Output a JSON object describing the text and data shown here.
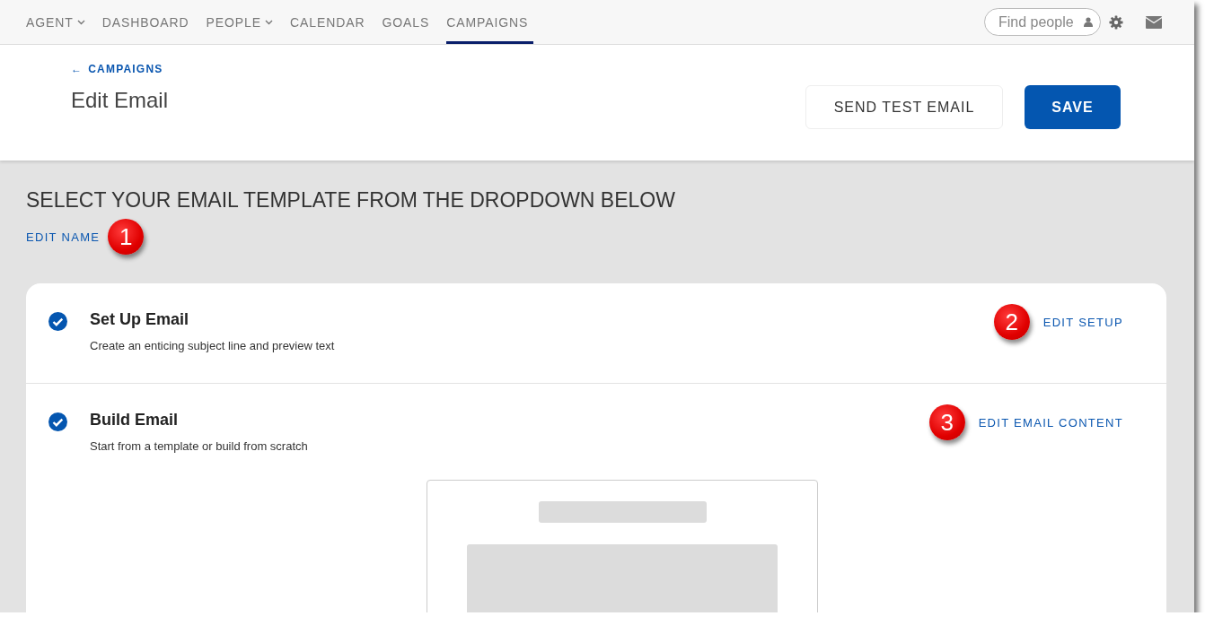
{
  "nav": {
    "items": [
      {
        "label": "AGENT",
        "dropdown": true,
        "selected": false
      },
      {
        "label": "DASHBOARD",
        "dropdown": false,
        "selected": false
      },
      {
        "label": "PEOPLE",
        "dropdown": true,
        "selected": false
      },
      {
        "label": "CALENDAR",
        "dropdown": false,
        "selected": false
      },
      {
        "label": "GOALS",
        "dropdown": false,
        "selected": false
      },
      {
        "label": "CAMPAIGNS",
        "dropdown": false,
        "selected": true
      }
    ],
    "search": {
      "placeholder": "Find people"
    }
  },
  "header": {
    "back_link": {
      "arrow": "←",
      "label": "CAMPAIGNS"
    },
    "title": "Edit Email",
    "buttons": [
      {
        "label": "SEND TEST EMAIL",
        "kind": "secondary"
      },
      {
        "label": "SAVE",
        "kind": "primary"
      }
    ]
  },
  "content": {
    "heading": "SELECT YOUR EMAIL TEMPLATE FROM THE DROPDOWN BELOW",
    "edit_link": "EDIT NAME",
    "edit_callout": "1",
    "steps": [
      {
        "title": "Set Up Email",
        "description": "Create an enticing subject line and preview text",
        "checked": true,
        "action": "EDIT SETUP",
        "callout": "2",
        "kind": "plain"
      },
      {
        "title": "Build Email",
        "description": "Start from a template or build from scratch",
        "checked": true,
        "action": "EDIT EMAIL CONTENT",
        "callout": "3",
        "kind": "preview"
      }
    ]
  }
}
